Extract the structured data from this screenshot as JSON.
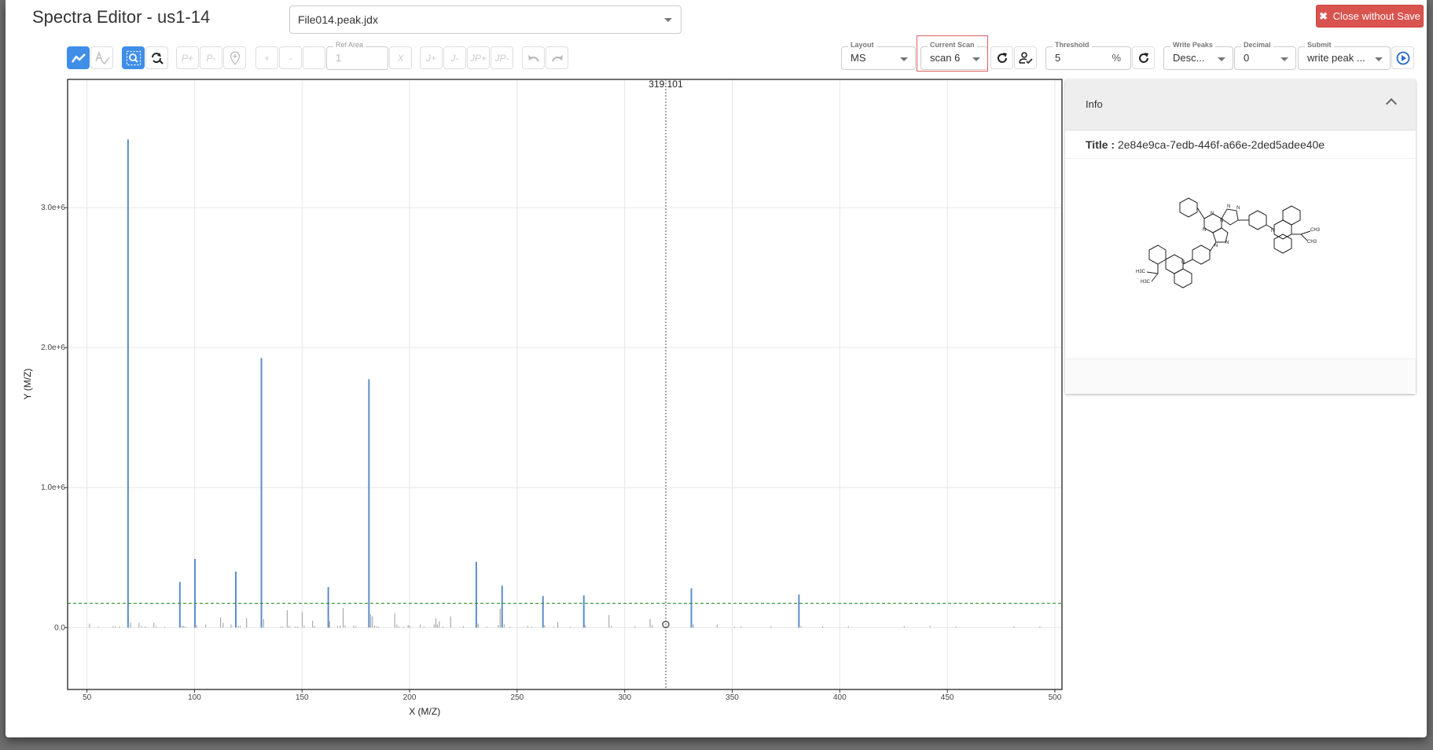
{
  "app": {
    "title": "Spectra Editor - us1-14",
    "file_select": {
      "value": "File014.peak.jdx"
    },
    "close_button": {
      "label": "Close without Save",
      "icon": "times-icon"
    }
  },
  "toolbar": {
    "view_buttons": [
      {
        "name": "spectrum-line",
        "icon": "line-chart-icon",
        "active": true
      },
      {
        "name": "spectrum-analysis",
        "icon": "text-check-icon",
        "active": false
      }
    ],
    "zoom_buttons": [
      {
        "name": "zoom-in",
        "icon": "zoom-select-icon",
        "active": true
      },
      {
        "name": "zoom-reset",
        "icon": "zoom-reset-icon",
        "active": false
      }
    ],
    "peak_buttons": [
      {
        "label": "P+"
      },
      {
        "label": "P-"
      },
      {
        "label": "",
        "icon": "pin-plus-icon"
      }
    ],
    "integration_buttons": [
      {
        "label": "+"
      },
      {
        "label": "-"
      },
      {
        "label": ""
      }
    ],
    "ref_area": {
      "label": "Ref Area",
      "value": "1"
    },
    "ref_area_clear": {
      "label": "X"
    },
    "multiplicity_buttons": [
      {
        "label": "J+"
      },
      {
        "label": "J-"
      },
      {
        "label": "JP+"
      },
      {
        "label": "JP-"
      }
    ],
    "history_buttons": [
      {
        "name": "undo",
        "icon": "undo-icon"
      },
      {
        "name": "redo",
        "icon": "redo-icon"
      }
    ],
    "layout": {
      "label": "Layout",
      "value": "MS"
    },
    "current_scan": {
      "label": "Current Scan",
      "value": "scan 6"
    },
    "scan_refresh_icon": "refresh-icon",
    "scan_auto_icon": "user-check-icon",
    "threshold": {
      "label": "Threshold",
      "value": "5",
      "unit": "%"
    },
    "threshold_refresh_icon": "refresh-icon",
    "write_peaks": {
      "label": "Write Peaks",
      "value": "Desc..."
    },
    "decimal": {
      "label": "Decimal",
      "value": "0"
    },
    "submit": {
      "label": "Submit",
      "value": "write peak ..."
    },
    "submit_icon": "play-circle-icon"
  },
  "info": {
    "header": "Info",
    "title_label": "Title :",
    "title_value": "2e84e9ca-7edb-446f-a66e-2ded5adee40e",
    "molecule": {
      "labels": [
        "N",
        "N",
        "N",
        "N",
        "N",
        "N",
        "N",
        "N",
        "N",
        "H3C",
        "H3C",
        "CH3",
        "CH3"
      ]
    }
  },
  "chart_data": {
    "type": "bar",
    "title": "",
    "xlabel": "X (M/Z)",
    "ylabel": "Y (M/Z)",
    "xlim": [
      41,
      503.3
    ],
    "ylim": [
      -442000,
      3916000
    ],
    "x_ticks": [
      50,
      100,
      150,
      200,
      250,
      300,
      350,
      400,
      450,
      500
    ],
    "x_tick_labels": [
      "50",
      "100",
      "150",
      "200",
      "250",
      "300",
      "350",
      "400",
      "450",
      "500"
    ],
    "y_ticks": [
      0,
      1000000,
      2000000,
      3000000
    ],
    "y_tick_labels": [
      "0.0",
      "1.0e+6",
      "2.0e+6",
      "3.0e+6"
    ],
    "grid": true,
    "threshold": 174000,
    "threshold_color": "#228B22",
    "cursor": {
      "x": 319.101,
      "label": "319.101"
    },
    "series": [
      {
        "name": "picked peaks",
        "color": "#5b8dc9",
        "x": [
          69.1,
          93.2,
          100.2,
          119.2,
          131.1,
          162.2,
          181.1,
          231.0,
          243.0,
          262.0,
          281.0,
          331.0,
          381.0
        ],
        "y": [
          3487000,
          326000,
          490000,
          400000,
          1925000,
          290000,
          1774000,
          470000,
          300000,
          225000,
          230000,
          280000,
          236000
        ]
      },
      {
        "name": "spectrum",
        "color": "#aaaaaa",
        "x": [
          51.2,
          55.3,
          62.2,
          63.2,
          65.1,
          70.3,
          74.2,
          75.4,
          77.2,
          81.1,
          82.2,
          86.1,
          94.3,
          94.9,
          95.7,
          101.0,
          105.2,
          112.1,
          113.3,
          117.0,
          120.3,
          121.3,
          124.2,
          132.1,
          140.0,
          141.0,
          143.1,
          144.0,
          147.0,
          148.0,
          150.1,
          151.0,
          154.9,
          155.8,
          162.8,
          166.5,
          167.7,
          169.1,
          170.0,
          174.0,
          175.0,
          181.9,
          182.7,
          183.7,
          184.6,
          185.6,
          193.1,
          194.1,
          195.1,
          197.1,
          199.3,
          200.0,
          205.0,
          206.6,
          211.4,
          212.2,
          212.9,
          213.8,
          215.5,
          219.1,
          225.0,
          231.9,
          236.0,
          241.3,
          242.1,
          244.0,
          246.7,
          254.9,
          256.8,
          262.8,
          266.9,
          268.9,
          274.7,
          281.7,
          292.7,
          293.8,
          304.9,
          311.8,
          312.8,
          331.9,
          343.0,
          351.0,
          354.0,
          368.0,
          382.0,
          392.0,
          404.0,
          430.0,
          442.0,
          454.0,
          481.0,
          493.0
        ],
        "y": [
          28000,
          6000,
          10000,
          10000,
          8000,
          37000,
          34000,
          10000,
          8000,
          34000,
          10000,
          6000,
          14000,
          10000,
          8000,
          17000,
          22000,
          72000,
          34000,
          22000,
          12000,
          12000,
          67000,
          62000,
          6000,
          8000,
          124000,
          14000,
          8000,
          8000,
          112000,
          14000,
          50000,
          10000,
          45000,
          10000,
          14000,
          140000,
          14000,
          14000,
          8000,
          95000,
          80000,
          14000,
          10000,
          8000,
          100000,
          22000,
          8000,
          8000,
          17000,
          14000,
          22000,
          8000,
          22000,
          67000,
          22000,
          45000,
          8000,
          79000,
          11000,
          28000,
          6000,
          17000,
          135000,
          22000,
          6000,
          11000,
          6000,
          17000,
          6000,
          39000,
          6000,
          17000,
          90000,
          11000,
          11000,
          62000,
          17000,
          22000,
          22000,
          8000,
          8000,
          11000,
          11000,
          11000,
          11000,
          11000,
          11000,
          8000,
          8000,
          8000
        ]
      }
    ]
  }
}
